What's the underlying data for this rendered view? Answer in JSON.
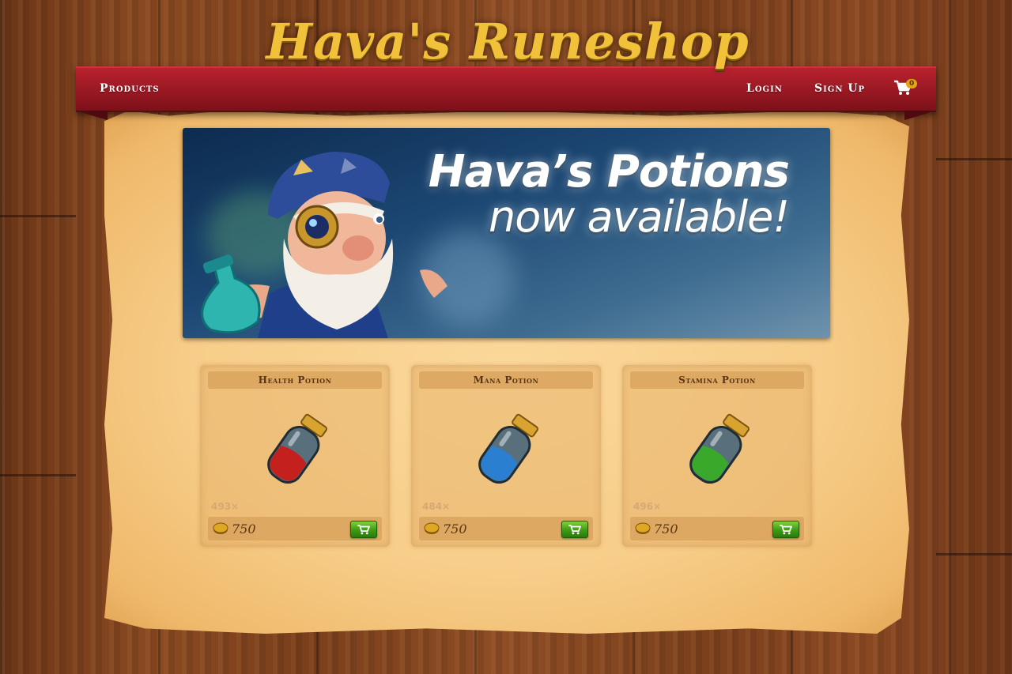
{
  "brand": {
    "title": "Hava's Runeshop"
  },
  "nav": {
    "products_label": "Products",
    "login_label": "Login",
    "signup_label": "Sign Up",
    "cart_count": "0"
  },
  "banner": {
    "title": "Hava’s Potions",
    "subtitle": "now available!"
  },
  "products": [
    {
      "name": "Health Potion",
      "stock": "493×",
      "price": "750",
      "liquid_color": "#c4201e"
    },
    {
      "name": "Mana Potion",
      "stock": "484×",
      "price": "750",
      "liquid_color": "#2a7fd0"
    },
    {
      "name": "Stamina Potion",
      "stock": "496×",
      "price": "750",
      "liquid_color": "#3aa82a"
    }
  ],
  "colors": {
    "ribbon": "#9e1a25",
    "parchment": "#f7cd89",
    "buy_button": "#3e9b14",
    "logo_gold": "#f2c13a"
  }
}
